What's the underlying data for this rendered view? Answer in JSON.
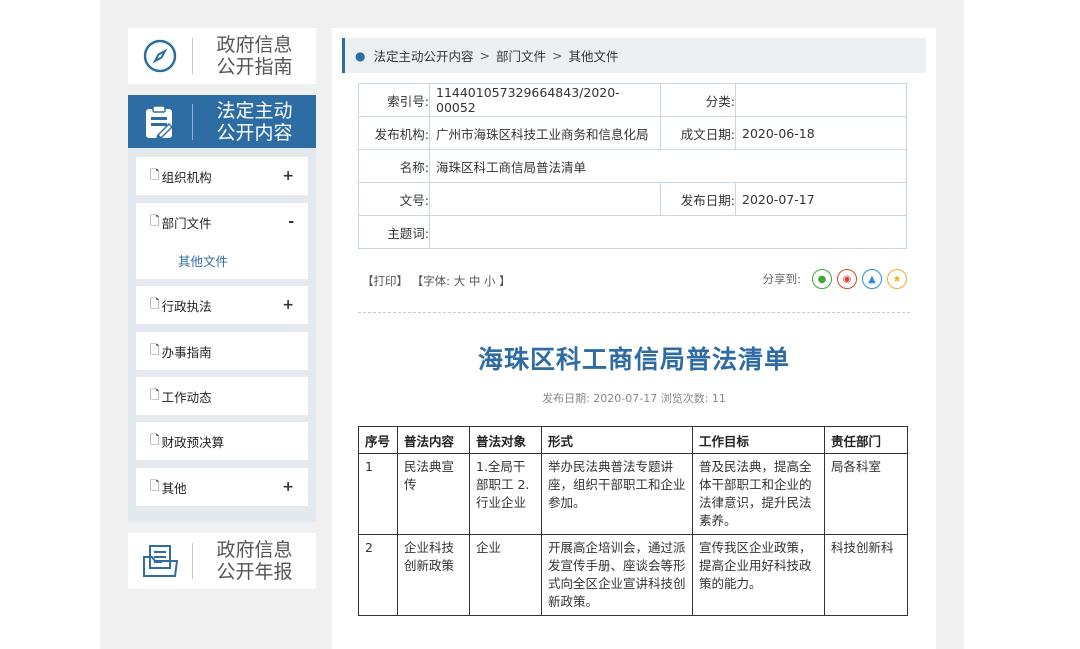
{
  "sidebar": {
    "guide": {
      "line1": "政府信息",
      "line2": "公开指南"
    },
    "main": {
      "line1": "法定主动",
      "line2": "公开内容"
    },
    "items": [
      {
        "label": "组织机构",
        "toggle": "+"
      },
      {
        "label": "部门文件",
        "toggle": "-"
      },
      {
        "label": "行政执法",
        "toggle": "+"
      },
      {
        "label": "办事指南",
        "toggle": ""
      },
      {
        "label": "工作动态",
        "toggle": ""
      },
      {
        "label": "财政预决算",
        "toggle": ""
      },
      {
        "label": "其他",
        "toggle": "+"
      }
    ],
    "subitem": "其他文件",
    "report": {
      "line1": "政府信息",
      "line2": "公开年报"
    }
  },
  "breadcrumb": {
    "c1": "法定主动公开内容",
    "c2": "部门文件",
    "c3": "其他文件",
    "sep": ">"
  },
  "meta": {
    "index_label": "索引号:",
    "index_value": "114401057329664843/2020-00052",
    "category_label": "分类:",
    "category_value": "",
    "org_label": "发布机构:",
    "org_value": "广州市海珠区科技工业商务和信息化局",
    "date_label": "成文日期:",
    "date_value": "2020-06-18",
    "name_label": "名称:",
    "name_value": "海珠区科工商信局普法清单",
    "docno_label": "文号:",
    "docno_value": "",
    "pubdate_label": "发布日期:",
    "pubdate_value": "2020-07-17",
    "keyword_label": "主题词:",
    "keyword_value": ""
  },
  "tools": {
    "print": "【打印】",
    "font": "【字体:",
    "large": "大",
    "medium": "中",
    "small": "小",
    "close": "】"
  },
  "share": {
    "label": "分享到:"
  },
  "article": {
    "title": "海珠区科工商信局普法清单",
    "pubinfo": "发布日期: 2020-07-17 浏览次数: 11"
  },
  "table": {
    "headers": [
      "序号",
      "普法内容",
      "普法对象",
      "形式",
      "工作目标",
      "责任部门"
    ],
    "rows": [
      [
        "1",
        "民法典宣传",
        "1.全局干部职工 2.行业企业",
        "举办民法典普法专题讲座，组织干部职工和企业参加。",
        "普及民法典，提高全体干部职工和企业的法律意识，提升民法素养。",
        "局各科室"
      ],
      [
        "2",
        "企业科技创新政策",
        "企业",
        "开展高企培训会，通过派发宣传手册、座谈会等形式向全区企业宣讲科技创新政策。",
        "宣传我区企业政策，提高企业用好科技政策的能力。",
        "科技创新科"
      ]
    ]
  },
  "colors": {
    "brand": "#2e6da4",
    "side_bg": "#e3e9ef",
    "page_bg": "#f0f0f0"
  }
}
